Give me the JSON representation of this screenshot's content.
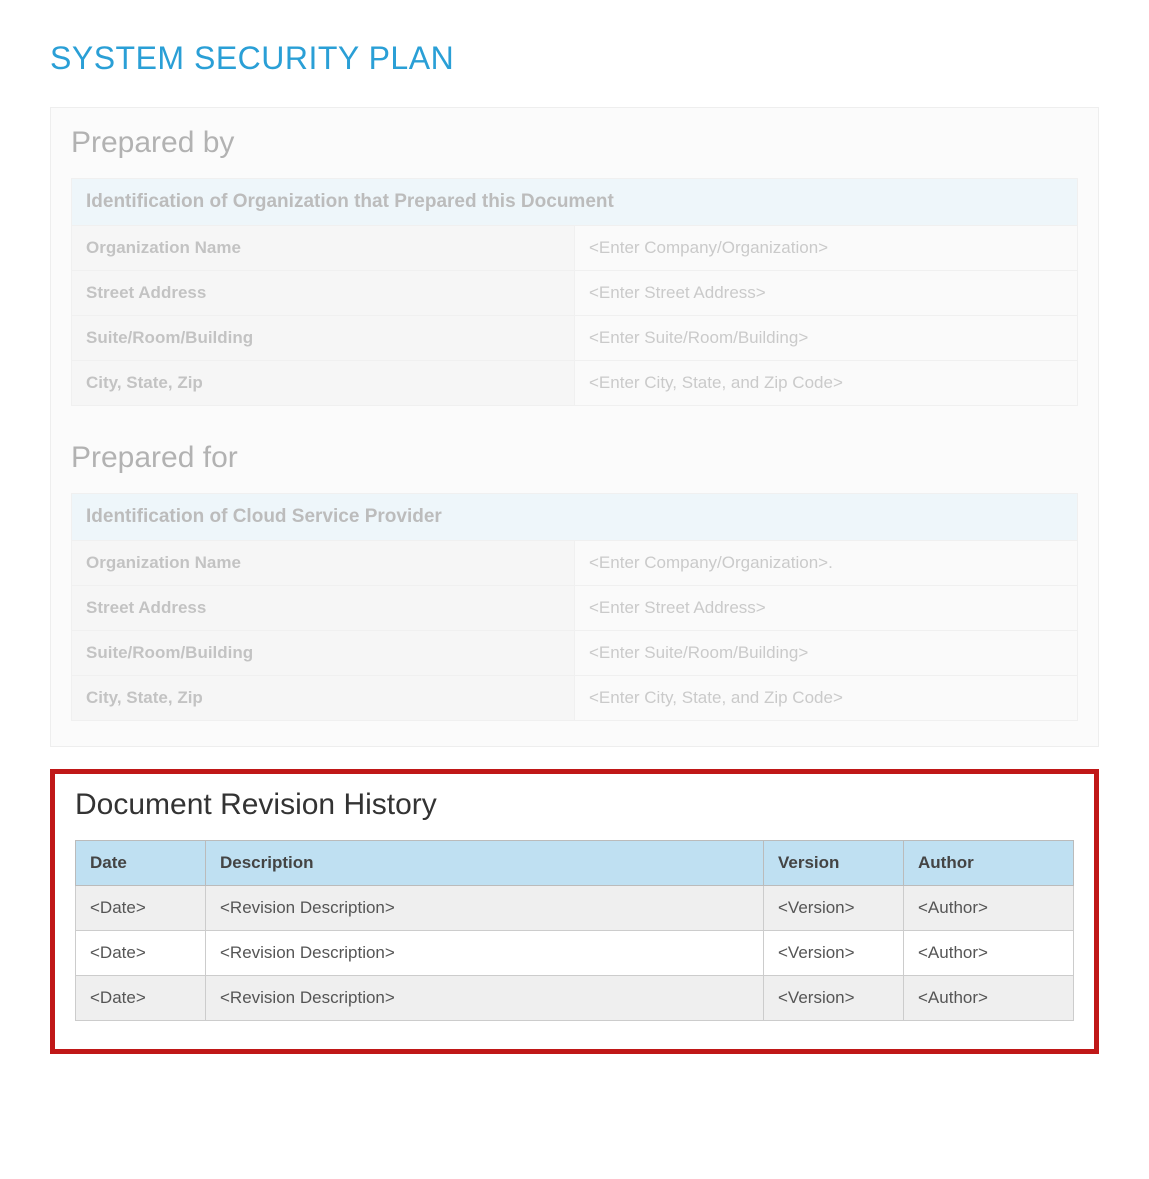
{
  "title": "SYSTEM SECURITY PLAN",
  "prepared_by": {
    "heading": "Prepared by",
    "banner": "Identification of Organization that Prepared this Document",
    "rows": [
      {
        "label": "Organization Name",
        "value": "<Enter Company/Organization>"
      },
      {
        "label": "Street Address",
        "value": "<Enter Street Address>"
      },
      {
        "label": "Suite/Room/Building",
        "value": "<Enter Suite/Room/Building>"
      },
      {
        "label": "City, State, Zip",
        "value": "<Enter City, State, and Zip Code>"
      }
    ]
  },
  "prepared_for": {
    "heading": "Prepared for",
    "banner": "Identification of Cloud Service Provider",
    "rows": [
      {
        "label": "Organization Name",
        "value": "<Enter Company/Organization>."
      },
      {
        "label": "Street Address",
        "value": "<Enter Street Address>"
      },
      {
        "label": "Suite/Room/Building",
        "value": "<Enter Suite/Room/Building>"
      },
      {
        "label": "City, State, Zip",
        "value": "<Enter City, State, and Zip Code>"
      }
    ]
  },
  "revision_history": {
    "heading": "Document Revision History",
    "columns": [
      "Date",
      "Description",
      "Version",
      "Author"
    ],
    "rows": [
      {
        "date": "<Date>",
        "description": "<Revision Description>",
        "version": "<Version>",
        "author": "<Author>"
      },
      {
        "date": "<Date>",
        "description": "<Revision Description>",
        "version": "<Version>",
        "author": "<Author>"
      },
      {
        "date": "<Date>",
        "description": "<Revision Description>",
        "version": "<Version>",
        "author": "<Author>"
      }
    ]
  }
}
